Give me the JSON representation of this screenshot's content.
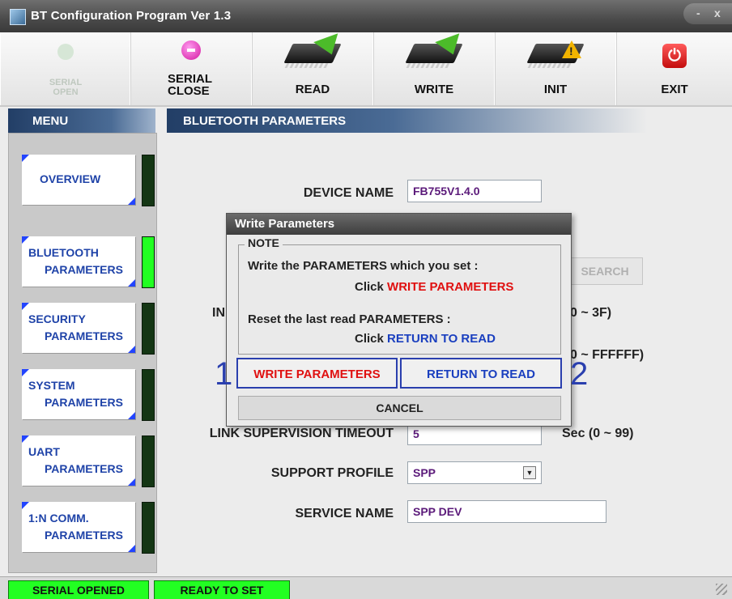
{
  "window": {
    "title": "BT Configuration Program Ver 1.3",
    "min_glyph": "-",
    "close_glyph": "x"
  },
  "toolbar": {
    "serial_open": {
      "line1": "SERIAL",
      "line2": "OPEN"
    },
    "serial_close": {
      "line1": "SERIAL",
      "line2": "CLOSE"
    },
    "read": "READ",
    "write": "WRITE",
    "init": "INIT",
    "exit": "EXIT",
    "icons": {
      "serial_open": "serial-open-icon",
      "serial_close": "disconnect-icon",
      "read": "chip-read-icon",
      "write": "chip-write-icon",
      "init": "chip-warning-icon",
      "exit": "power-icon"
    }
  },
  "menu": {
    "header": "MENU",
    "items": [
      {
        "line1": "OVERVIEW",
        "line2": "",
        "active": false
      },
      {
        "line1": "BLUETOOTH",
        "line2": "PARAMETERS",
        "active": true
      },
      {
        "line1": "SECURITY",
        "line2": "PARAMETERS",
        "active": false
      },
      {
        "line1": "SYSTEM",
        "line2": "PARAMETERS",
        "active": false
      },
      {
        "line1": "UART",
        "line2": "PARAMETERS",
        "active": false
      },
      {
        "line1": "1:N COMM.",
        "line2": "PARAMETERS",
        "active": false
      }
    ]
  },
  "main": {
    "header": "BLUETOOTH PARAMETERS",
    "device_name_label": "DEVICE NAME",
    "device_name_value": "FB755V1.4.0",
    "search_label": "SEARCH",
    "partial_label": "IN",
    "range1": "0 ~ 3F)",
    "range2": "0 ~ FFFFFF)",
    "link_supervision_label": "LINK SUPERVISION TIMEOUT",
    "link_supervision_value": "5",
    "link_supervision_unit": "Sec (0 ~ 99)",
    "support_profile_label": "SUPPORT PROFILE",
    "support_profile_value": "SPP",
    "service_name_label": "SERVICE NAME",
    "service_name_value": "SPP DEV"
  },
  "dialog": {
    "title": "Write Parameters",
    "note_legend": "NOTE",
    "line1": "Write the PARAMETERS which you set :",
    "line2_prefix": "Click ",
    "line2_action": "WRITE PARAMETERS",
    "line3": "Reset the last read PARAMETERS :",
    "line4_prefix": "Click ",
    "line4_action": "RETURN TO READ",
    "write_button": "WRITE PARAMETERS",
    "return_button": "RETURN TO READ",
    "cancel_button": "CANCEL"
  },
  "annotations": {
    "one": "1",
    "two": "2"
  },
  "status": {
    "serial": "SERIAL OPENED",
    "ready": "READY TO SET"
  },
  "colors": {
    "accent": "#2a3fae",
    "status_green": "#22ff22",
    "red_text": "#e01010"
  }
}
